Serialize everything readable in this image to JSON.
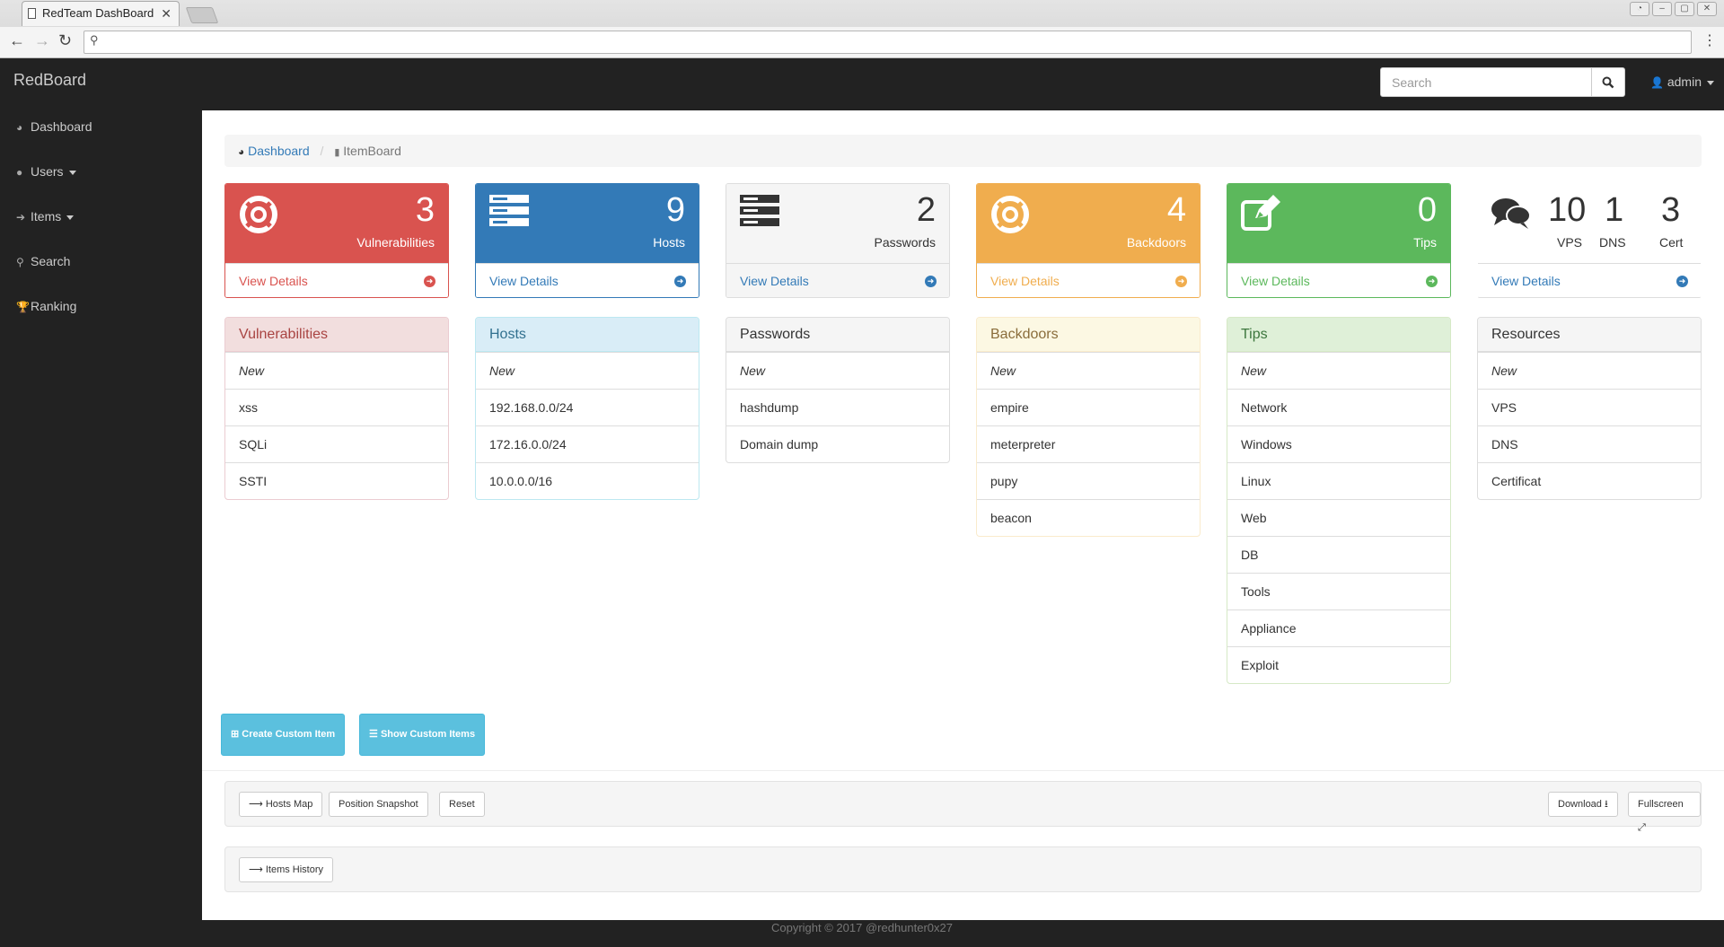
{
  "browser": {
    "tab_title": "RedTeam DashBoard",
    "tab_close": "✕",
    "address": ""
  },
  "navbar": {
    "brand": "RedBoard",
    "search_placeholder": "Search",
    "user": "admin"
  },
  "sidebar": {
    "items": [
      {
        "label": "Dashboard",
        "icon": "dashboard-icon"
      },
      {
        "label": "Users",
        "icon": "user-icon",
        "dropdown": true
      },
      {
        "label": "Items",
        "icon": "circle-arrow-icon",
        "dropdown": true
      },
      {
        "label": "Search",
        "icon": "search-icon"
      },
      {
        "label": "Ranking",
        "icon": "trophy-icon"
      }
    ]
  },
  "breadcrumb": {
    "home": "Dashboard",
    "current": "ItemBoard"
  },
  "stats": [
    {
      "value": "3",
      "label": "Vulnerabilities",
      "link": "View Details",
      "color": "#d9534f"
    },
    {
      "value": "9",
      "label": "Hosts",
      "link": "View Details",
      "color": "#337ab7"
    },
    {
      "value": "2",
      "label": "Passwords",
      "link": "View Details",
      "color": "#f5f5f5"
    },
    {
      "value": "4",
      "label": "Backdoors",
      "link": "View Details",
      "color": "#f0ad4e"
    },
    {
      "value": "0",
      "label": "Tips",
      "link": "View Details",
      "color": "#5cb85c"
    }
  ],
  "resources_stat": {
    "items": [
      {
        "value": "10",
        "label": "VPS"
      },
      {
        "value": "1",
        "label": "DNS"
      },
      {
        "value": "3",
        "label": "Cert"
      }
    ],
    "link": "View Details"
  },
  "lists": [
    {
      "title": "Vulnerabilities",
      "items": [
        "New",
        "xss",
        "SQLi",
        "SSTI"
      ]
    },
    {
      "title": "Hosts",
      "items": [
        "New",
        "192.168.0.0/24",
        "172.16.0.0/24",
        "10.0.0.0/16"
      ]
    },
    {
      "title": "Passwords",
      "items": [
        "New",
        "hashdump",
        "Domain dump"
      ]
    },
    {
      "title": "Backdoors",
      "items": [
        "New",
        "empire",
        "meterpreter",
        "pupy",
        "beacon"
      ]
    },
    {
      "title": "Tips",
      "items": [
        "New",
        "Network",
        "Windows",
        "Linux",
        "Web",
        "DB",
        "Tools",
        "Appliance",
        "Exploit"
      ]
    },
    {
      "title": "Resources",
      "items": [
        "New",
        "VPS",
        "DNS",
        "Certificat"
      ]
    }
  ],
  "actions": {
    "create": "Create Custom Item",
    "show": "Show Custom Items"
  },
  "map_toolbar": {
    "hosts_map": "Hosts Map",
    "snapshot": "Position Snapshot",
    "reset": "Reset",
    "download": "Download",
    "fullscreen": "Fullscreen"
  },
  "history_toolbar": {
    "items_history": "Items History"
  },
  "footer": {
    "copyright": "Copyright © 2017 @redhunter0x27"
  }
}
